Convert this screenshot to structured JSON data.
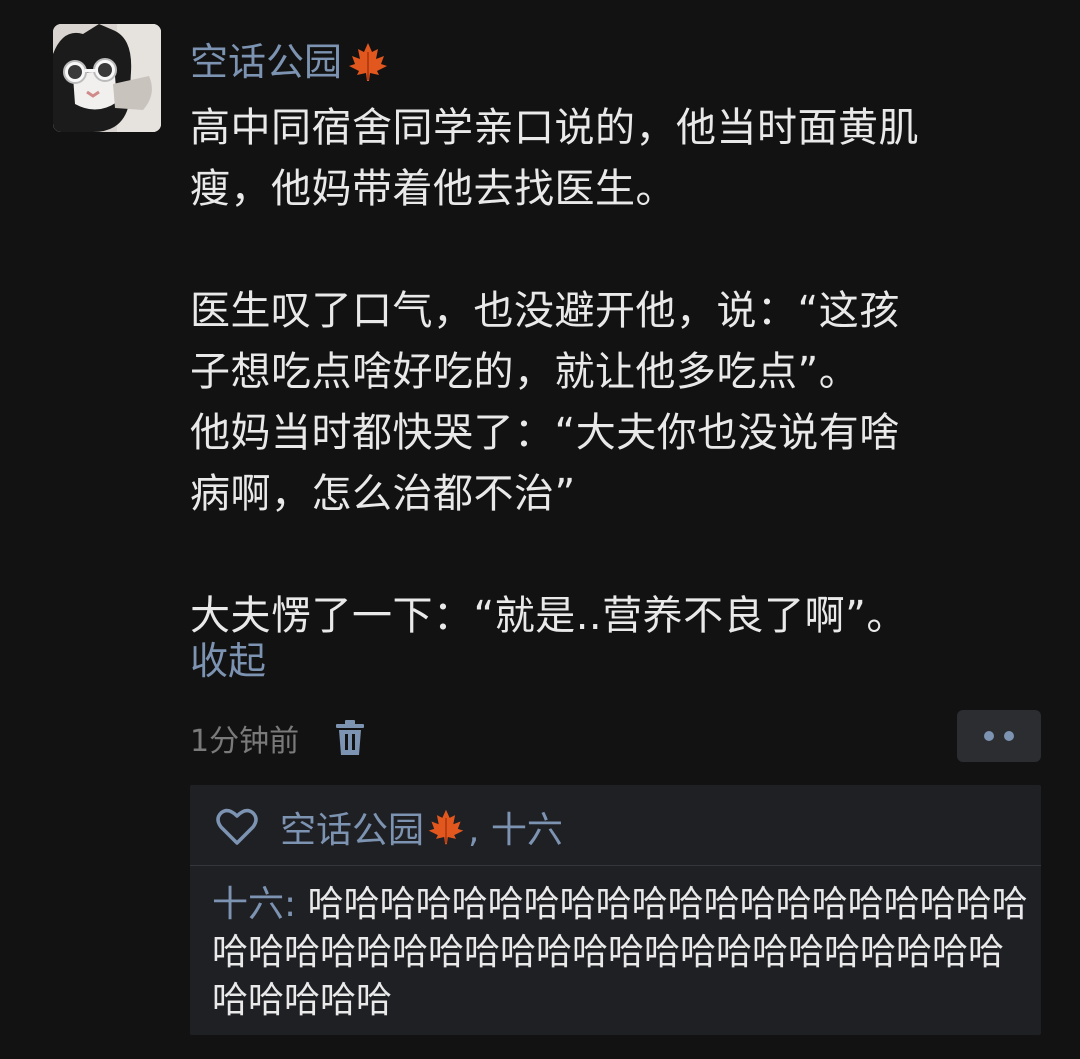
{
  "post": {
    "author": "空话公园",
    "author_badge_icon": "maple-leaf-icon",
    "content": {
      "lines_p1": [
        "高中同宿舍同学亲口说的，他当时面黄肌",
        "瘦，他妈带着他去找医生。"
      ],
      "lines_p2": [
        "医生叹了口气，也没避开他，说：“这孩",
        "子想吃点啥好吃的，就让他多吃点”。",
        "他妈当时都快哭了：“大夫你也没说有啥",
        "病啊，怎么治都不治”"
      ],
      "lines_p3": [
        "大夫愣了一下：“就是..营养不良了啊”。"
      ]
    },
    "collapse_label": "收起",
    "timestamp": "1分钟前",
    "delete_icon": "trash-icon",
    "more_icon": "more-dots-icon"
  },
  "reactions": {
    "like_icon": "heart-icon",
    "likers_name1": "空话公园",
    "likers_rest": ", 十六",
    "comments": [
      {
        "author": "十六:",
        "text": " 哈哈哈哈哈哈哈哈哈哈哈哈哈哈哈哈哈哈哈哈哈哈哈哈哈哈哈哈哈哈哈哈哈哈哈哈哈哈哈哈哈哈哈哈哈哈哈"
      }
    ]
  },
  "colors": {
    "background": "#121212",
    "link": "#7d93b2",
    "text": "#e9e9e9",
    "muted": "#7a7a7a",
    "panel": "#1f2024"
  }
}
